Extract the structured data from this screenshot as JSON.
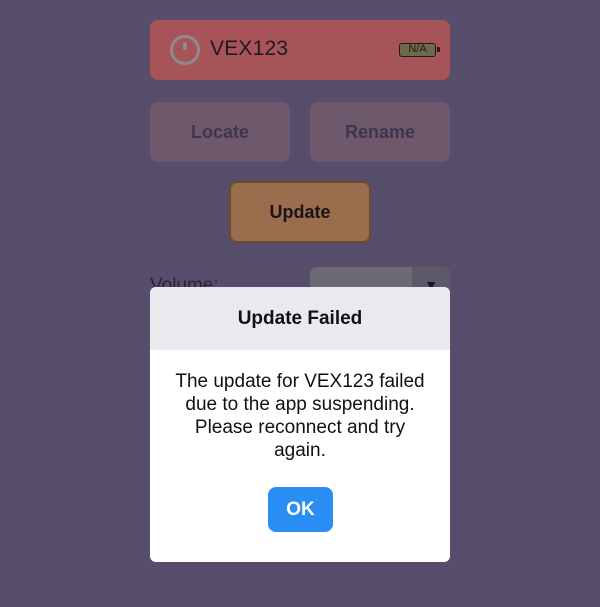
{
  "device": {
    "name": "VEX123",
    "battery_label": "N/A",
    "icon": "power-ring-icon"
  },
  "actions": {
    "locate_label": "Locate",
    "rename_label": "Rename",
    "update_label": "Update"
  },
  "volume": {
    "label": "Volume:",
    "selected_value": "",
    "dropdown_icon": "caret-down-icon"
  },
  "dialog": {
    "title": "Update Failed",
    "message": "The update for VEX123 failed due to the app suspending. Please reconnect and try again.",
    "ok_label": "OK"
  },
  "colors": {
    "ok_button": "#2b8ef5",
    "device_bar": "#a65458",
    "update_button": "#9a6e4c"
  }
}
